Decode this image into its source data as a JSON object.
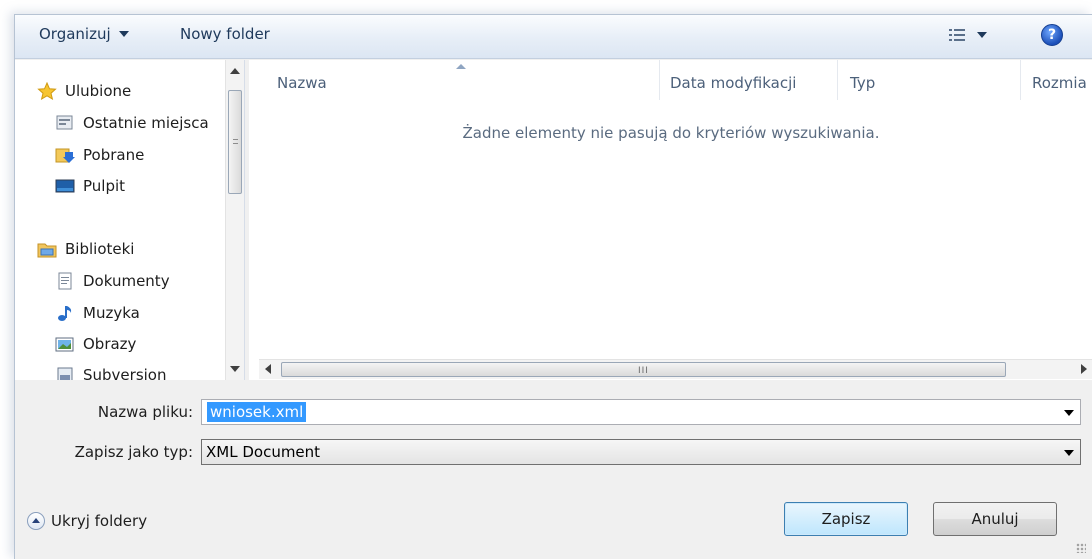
{
  "toolbar": {
    "organize_label": "Organizuj",
    "new_folder_label": "Nowy folder",
    "views_icon": "details-view-icon",
    "help_label": "?"
  },
  "nav": {
    "favorites": {
      "label": "Ulubione",
      "icon": "star-icon"
    },
    "favorites_items": [
      {
        "label": "Ostatnie miejsca",
        "icon": "recent-places-icon"
      },
      {
        "label": "Pobrane",
        "icon": "downloads-icon"
      },
      {
        "label": "Pulpit",
        "icon": "desktop-icon"
      }
    ],
    "libraries": {
      "label": "Biblioteki",
      "icon": "libraries-icon"
    },
    "libraries_items": [
      {
        "label": "Dokumenty",
        "icon": "documents-icon"
      },
      {
        "label": "Muzyka",
        "icon": "music-icon"
      },
      {
        "label": "Obrazy",
        "icon": "pictures-icon"
      },
      {
        "label": "Subversion",
        "icon": "subversion-icon"
      }
    ]
  },
  "content": {
    "columns": [
      "Nazwa",
      "Data modyfikacji",
      "Typ",
      "Rozmia"
    ],
    "empty_message": "Żadne elementy nie pasują do kryteriów wyszukiwania.",
    "hscroll_grip": "III"
  },
  "form": {
    "file_name_label": "Nazwa pliku:",
    "file_name_value": "wniosek.xml",
    "save_type_label": "Zapisz jako typ:",
    "save_type_value": "XML Document"
  },
  "footer": {
    "hide_folders_label": "Ukryj foldery",
    "save_label": "Zapisz",
    "cancel_label": "Anuluj"
  },
  "colors": {
    "selection": "#3399ff",
    "default_button": "#bee6fd",
    "toolbar": "#dce6f3"
  }
}
